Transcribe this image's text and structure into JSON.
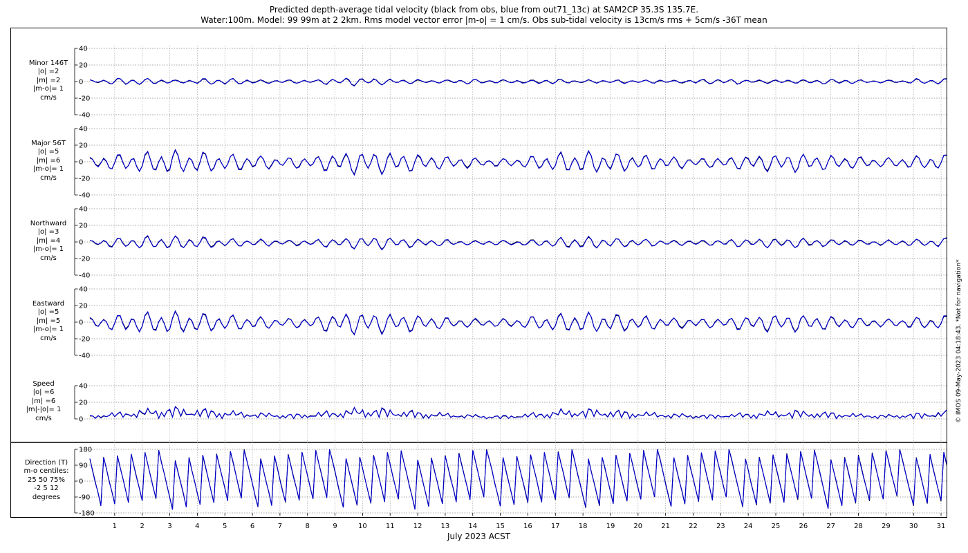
{
  "figure": {
    "title_line1": "Predicted depth-average tidal velocity (black from obs, blue from out71_13c) at SAM2CP 35.3S 135.7E.",
    "title_line2": "Water:100m. Model: 99 99m at 2 2km. Rms model vector error |m-o| = 1 cm/s. Obs sub-tidal velocity is 13cm/s rms + 5cm/s -36T mean",
    "xlabel": "July 2023 ACST",
    "copyright": "© IMOS 09-May-2023 04:18:43. *Not for navigation*"
  },
  "panels": [
    {
      "id": "minor",
      "label_lines": [
        "Minor 146T",
        "|o| =2",
        "|m| =2",
        "|m-o|= 1",
        "cm/s"
      ],
      "ylim": [
        -40,
        40
      ],
      "yticks": [
        "40",
        "20",
        "0",
        "-20",
        "-40"
      ],
      "yticks_values": [
        40,
        20,
        0,
        -20,
        -40
      ]
    },
    {
      "id": "major",
      "label_lines": [
        "Major 56T",
        "|o| =5",
        "|m| =6",
        "|m-o|= 1",
        "cm/s"
      ],
      "ylim": [
        -40,
        40
      ],
      "yticks": [
        "40",
        "20",
        "0",
        "-20",
        "-40"
      ],
      "yticks_values": [
        40,
        20,
        0,
        -20,
        -40
      ]
    },
    {
      "id": "north",
      "label_lines": [
        "Northward",
        "|o| =3",
        "|m| =4",
        "|m-o|= 1",
        "cm/s"
      ],
      "ylim": [
        -40,
        40
      ],
      "yticks": [
        "40",
        "20",
        "0",
        "-20",
        "-40"
      ],
      "yticks_values": [
        40,
        20,
        0,
        -20,
        -40
      ]
    },
    {
      "id": "east",
      "label_lines": [
        "Eastward",
        "|o| =5",
        "|m| =5",
        "|m-o|= 1",
        "cm/s"
      ],
      "ylim": [
        -40,
        40
      ],
      "yticks": [
        "40",
        "20",
        "0",
        "-20",
        "-40"
      ],
      "yticks_values": [
        40,
        20,
        0,
        -20,
        -40
      ]
    },
    {
      "id": "speed",
      "label_lines": [
        "Speed",
        "|o| =6",
        "|m| =6",
        "|m|-|o|= 1",
        "cm/s"
      ],
      "ylim": [
        0,
        40
      ],
      "yticks": [
        "40",
        "20",
        "0"
      ],
      "yticks_values": [
        40,
        20,
        0
      ]
    },
    {
      "id": "direction",
      "label_lines": [
        "Direction (T)",
        "m-o centiles:",
        "25  50  75%",
        "-2   5   12",
        "degrees"
      ],
      "ylim": [
        -180,
        180
      ],
      "yticks": [
        "180",
        "90",
        "0",
        "-90",
        "-180"
      ],
      "yticks_values": [
        180,
        90,
        0,
        -90,
        -180
      ]
    }
  ],
  "chart_data": {
    "type": "line",
    "title": "Predicted depth-average tidal velocity (black from obs, blue from out71_13c) at SAM2CP 35.3S 135.7E.",
    "xlabel": "July 2023 ACST",
    "x_ticks": [
      "1",
      "2",
      "3",
      "4",
      "5",
      "6",
      "7",
      "8",
      "9",
      "10",
      "11",
      "12",
      "13",
      "14",
      "15",
      "16",
      "17",
      "18",
      "19",
      "20",
      "21",
      "22",
      "23",
      "24",
      "25",
      "26",
      "27",
      "28",
      "29",
      "30",
      "31"
    ],
    "x_range_days": [
      0.1,
      31.2
    ],
    "series_colors": {
      "obs": "#000000",
      "model": "#0000cc"
    },
    "grid": true,
    "sample_step_days": 0.1,
    "envelope_day_step": 0.5,
    "series_amplitudes_cm_s": {
      "minor": [
        2,
        3,
        4,
        5,
        4,
        3,
        2,
        2,
        3,
        4,
        4,
        3,
        2,
        2,
        2,
        2,
        2,
        3,
        4,
        5,
        4,
        4,
        3,
        3,
        2,
        2,
        2,
        3,
        3,
        2,
        2,
        2,
        2,
        3,
        3,
        2,
        2,
        2,
        2,
        2,
        2,
        2,
        2,
        2,
        3,
        3,
        3,
        3,
        2,
        2,
        2,
        2,
        2,
        3,
        3,
        3,
        2,
        2,
        2,
        2,
        3,
        3,
        4
      ],
      "major": [
        6,
        9,
        10,
        12,
        13,
        14,
        15,
        14,
        13,
        12,
        11,
        10,
        9,
        8,
        7,
        7,
        8,
        10,
        12,
        14,
        15,
        14,
        13,
        12,
        10,
        9,
        8,
        7,
        6,
        5,
        5,
        6,
        8,
        10,
        12,
        13,
        14,
        13,
        12,
        11,
        10,
        9,
        8,
        7,
        6,
        6,
        7,
        8,
        9,
        10,
        11,
        12,
        11,
        10,
        9,
        8,
        7,
        6,
        6,
        7,
        8,
        9,
        10
      ],
      "north": [
        3,
        5,
        6,
        7,
        8,
        8,
        8,
        8,
        7,
        6,
        5,
        5,
        4,
        4,
        3,
        3,
        4,
        5,
        6,
        7,
        8,
        8,
        7,
        6,
        5,
        4,
        4,
        3,
        3,
        3,
        3,
        3,
        4,
        5,
        6,
        7,
        7,
        7,
        6,
        5,
        5,
        4,
        4,
        3,
        3,
        3,
        4,
        5,
        5,
        6,
        6,
        6,
        6,
        5,
        4,
        4,
        3,
        3,
        3,
        4,
        4,
        5,
        6
      ],
      "east": [
        6,
        9,
        10,
        12,
        13,
        14,
        14,
        13,
        12,
        11,
        10,
        9,
        8,
        7,
        6,
        6,
        8,
        10,
        12,
        14,
        14,
        13,
        12,
        11,
        10,
        8,
        7,
        6,
        5,
        5,
        5,
        6,
        8,
        10,
        11,
        12,
        13,
        12,
        11,
        10,
        9,
        8,
        7,
        6,
        6,
        6,
        7,
        8,
        9,
        10,
        11,
        11,
        10,
        9,
        8,
        7,
        6,
        5,
        5,
        6,
        7,
        8,
        9
      ],
      "speed": [
        4,
        7,
        8,
        11,
        12,
        14,
        15,
        14,
        13,
        12,
        10,
        9,
        8,
        7,
        6,
        6,
        7,
        9,
        11,
        13,
        14,
        14,
        12,
        11,
        9,
        8,
        7,
        6,
        5,
        4,
        4,
        5,
        7,
        9,
        11,
        12,
        13,
        12,
        11,
        10,
        9,
        8,
        7,
        6,
        5,
        5,
        6,
        7,
        8,
        9,
        10,
        11,
        10,
        9,
        8,
        7,
        6,
        5,
        5,
        6,
        7,
        8,
        10
      ],
      "direction_mean_deg": [
        90,
        80,
        70,
        60,
        50,
        45,
        40,
        40,
        45,
        50,
        55,
        60,
        65,
        70,
        75,
        80,
        70,
        60,
        50,
        45,
        40,
        40,
        45,
        50,
        55,
        60,
        70,
        80,
        90,
        100,
        90,
        80,
        70,
        60,
        50,
        45,
        40,
        40,
        45,
        50,
        55,
        60,
        65,
        70,
        75,
        80,
        85,
        80,
        75,
        70,
        65,
        60,
        55,
        50,
        50,
        55,
        60,
        65,
        70,
        75,
        80,
        85,
        90
      ]
    }
  }
}
